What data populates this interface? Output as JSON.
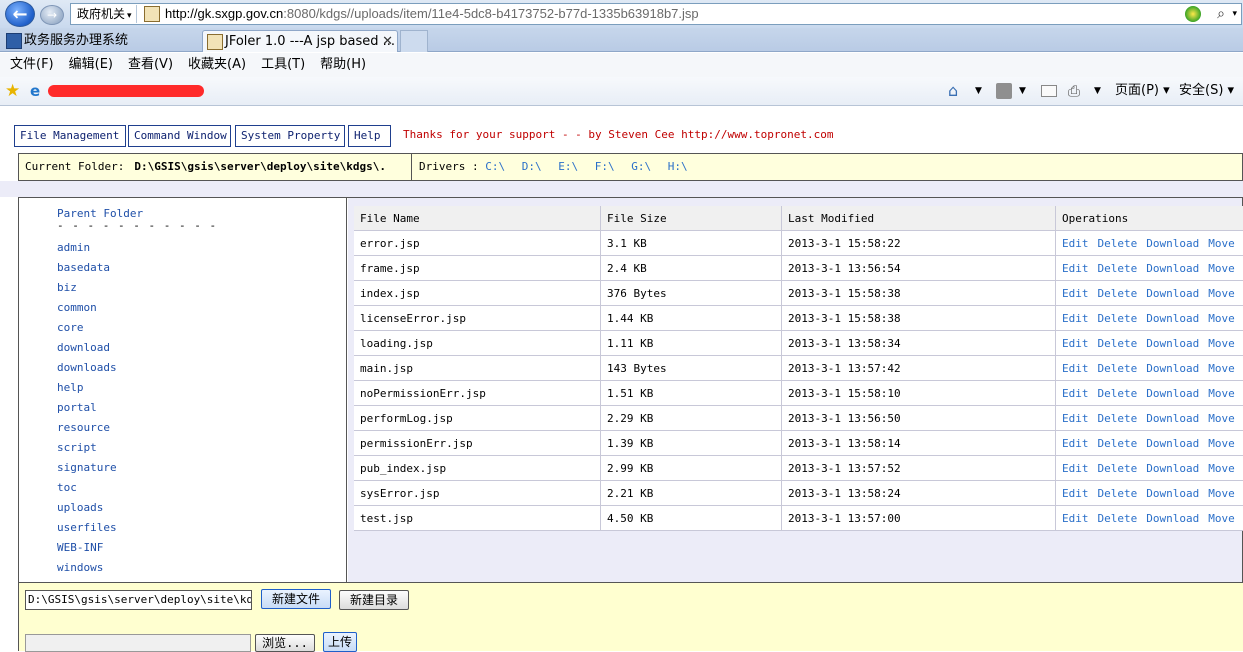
{
  "browser": {
    "site_badge": "政府机关",
    "url_host": "http://gk.sxgp.gov.cn",
    "url_rest": ":8080/kdgs//uploads/item/11e4-5dc8-b4173752-b77d-1335b63918b7.jsp",
    "tabs": [
      {
        "label": "政务服务办理系统"
      },
      {
        "label": "JFoler 1.0 ---A jsp based ..."
      }
    ],
    "tab_close": "✕",
    "menu": [
      "文件(F)",
      "编辑(E)",
      "查看(V)",
      "收藏夹(A)",
      "工具(T)",
      "帮助(H)"
    ],
    "command_bar": {
      "page": "页面(P) ▾",
      "safety": "安全(S) ▾"
    }
  },
  "jfoler": {
    "nav": {
      "file_management": "File Management",
      "command_window": "Command Window",
      "system_property": "System Property",
      "help": "Help"
    },
    "thanks": "Thanks for your support - - by Steven Cee http://www.topronet.com",
    "current_folder_label": "Current Folder:",
    "current_folder": "D:\\GSIS\\gsis\\server\\deploy\\site\\kdgs\\.",
    "drivers_label": "Drivers :",
    "drivers": [
      "C:\\",
      "D:\\",
      "E:\\",
      "F:\\",
      "G:\\",
      "H:\\"
    ],
    "parent_folder": "Parent Folder",
    "dashes": "- - - - - - - - - - -",
    "folders": [
      "admin",
      "basedata",
      "biz",
      "common",
      "core",
      "download",
      "downloads",
      "help",
      "portal",
      "resource",
      "script",
      "signature",
      "toc",
      "uploads",
      "userfiles",
      "WEB-INF",
      "windows"
    ],
    "table": {
      "headers": [
        "File Name",
        "File Size",
        "Last Modified",
        "Operations"
      ],
      "operations": [
        "Edit",
        "Delete",
        "Download",
        "Move"
      ],
      "rows": [
        {
          "name": "error.jsp",
          "size": "3.1 KB",
          "modified": "2013-3-1 15:58:22"
        },
        {
          "name": "frame.jsp",
          "size": "2.4 KB",
          "modified": "2013-3-1 13:56:54"
        },
        {
          "name": "index.jsp",
          "size": "376 Bytes",
          "modified": "2013-3-1 15:58:38"
        },
        {
          "name": "licenseError.jsp",
          "size": "1.44 KB",
          "modified": "2013-3-1 15:58:38"
        },
        {
          "name": "loading.jsp",
          "size": "1.11 KB",
          "modified": "2013-3-1 13:58:34"
        },
        {
          "name": "main.jsp",
          "size": "143 Bytes",
          "modified": "2013-3-1 13:57:42"
        },
        {
          "name": "noPermissionErr.jsp",
          "size": "1.51 KB",
          "modified": "2013-3-1 15:58:10"
        },
        {
          "name": "performLog.jsp",
          "size": "2.29 KB",
          "modified": "2013-3-1 13:56:50"
        },
        {
          "name": "permissionErr.jsp",
          "size": "1.39 KB",
          "modified": "2013-3-1 13:58:14"
        },
        {
          "name": "pub_index.jsp",
          "size": "2.99 KB",
          "modified": "2013-3-1 13:57:52"
        },
        {
          "name": "sysError.jsp",
          "size": "2.21 KB",
          "modified": "2013-3-1 13:58:24"
        },
        {
          "name": "test.jsp",
          "size": "4.50 KB",
          "modified": "2013-3-1 13:57:00"
        }
      ]
    },
    "path_input_value": "D:\\GSIS\\gsis\\server\\deploy\\site\\kdgs\\",
    "new_file_button": "新建文件",
    "new_dir_button": "新建目录",
    "browse_button": "浏览...",
    "upload_button": "上传"
  }
}
